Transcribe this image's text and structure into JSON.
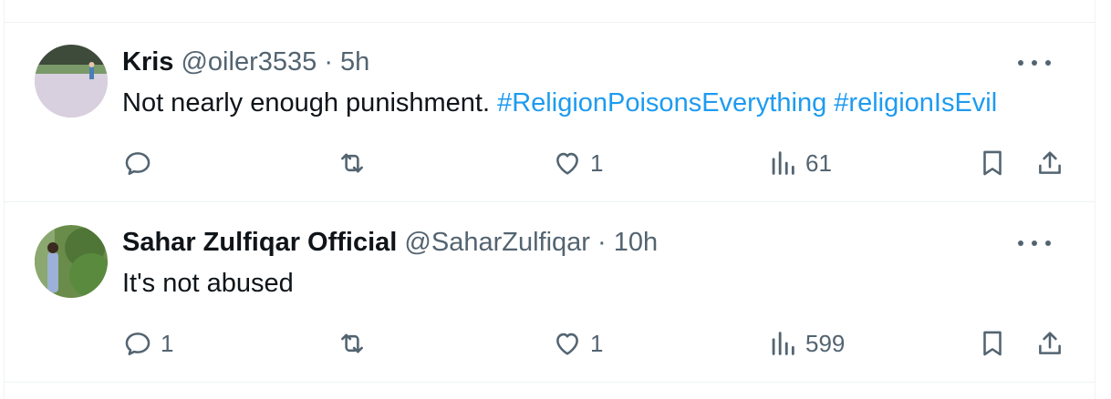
{
  "tweets": [
    {
      "name": "Kris",
      "handle": "@oiler3535",
      "separator": "·",
      "time": "5h",
      "text": "Not nearly enough punishment.",
      "hashtags": [
        "#ReligionPoisonsEverything",
        "#religionIsEvil"
      ],
      "actions": {
        "reply_count": "",
        "retweet_count": "",
        "like_count": "1",
        "views_count": "61"
      }
    },
    {
      "name": "Sahar Zulfiqar Official",
      "handle": "@SaharZulfiqar",
      "separator": "·",
      "time": "10h",
      "text": "It's not abused",
      "hashtags": [],
      "actions": {
        "reply_count": "1",
        "retweet_count": "",
        "like_count": "1",
        "views_count": "599"
      }
    }
  ],
  "icons": {
    "more": "more-horizontal-icon",
    "reply": "reply-icon",
    "retweet": "retweet-icon",
    "like": "heart-icon",
    "views": "views-icon",
    "bookmark": "bookmark-icon",
    "share": "share-icon"
  },
  "colors": {
    "text": "#0f1419",
    "secondary": "#536471",
    "hashtag": "#1d9bf0",
    "border": "#eff3f4"
  }
}
